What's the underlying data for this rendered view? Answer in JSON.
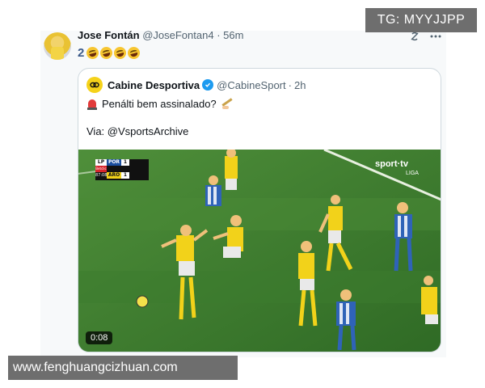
{
  "post": {
    "author_name": "Jose Fontán",
    "author_handle": "@JoseFontan4",
    "separator": "·",
    "time": "56m",
    "text_number": "2",
    "laugh_emoji_count": 4
  },
  "quote": {
    "name": "Cabine Desportiva",
    "handle": "@CabineSport",
    "separator": "·",
    "time": "2h",
    "line1": "Penálti bem assinalado?",
    "line2": "Via: @VsportsArchive",
    "verified_color": "#1d9bf0"
  },
  "video": {
    "duration": "0:08",
    "broadcaster": "sport·tv",
    "broadcaster_sub": "LIGA",
    "scoreboard": {
      "competition": "LP",
      "sponsor": "Betclic",
      "clock": "87:08",
      "home_team": "POR",
      "home_score": "1",
      "away_team": "ARO",
      "away_score": "1"
    }
  },
  "icons": [
    "grok-icon",
    "more-icon"
  ],
  "watermarks": {
    "top": "TG: MYYJJPP",
    "bottom": "www.fenghuangcizhuan.com"
  }
}
